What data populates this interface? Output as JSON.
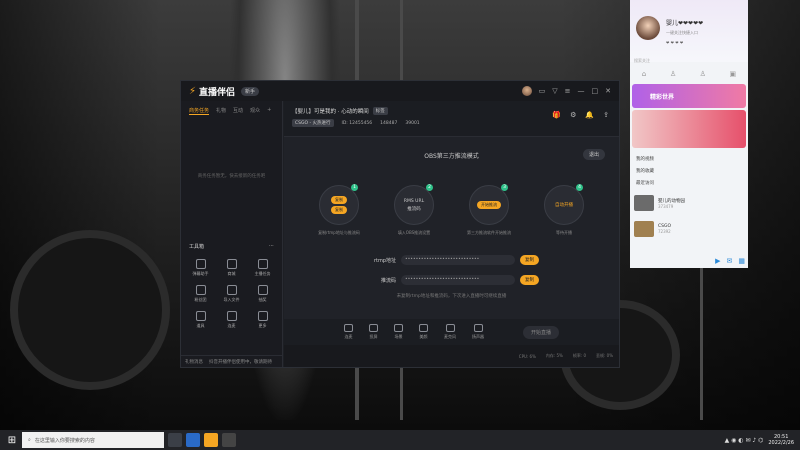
{
  "app": {
    "logo": "直播伴侣",
    "guide": "新手",
    "left_tabs": [
      "商务任务",
      "礼物",
      "互动",
      "观众"
    ],
    "empty_text": "商务任务暂无，快去接新的任务吧",
    "tools_title": "工具箱",
    "tools": [
      "弹幕助手",
      "商城",
      "主播任务",
      "粉丝团",
      "导入文件",
      "抽奖",
      "道具",
      "连麦",
      "更多"
    ],
    "footer_left": "礼物消息",
    "footer_text": "抖音开播伴侣使用中，敬请期待",
    "room": {
      "title": "【婴儿】可是我的 · 心动的瞬间",
      "title_tag": "标签",
      "category": "CSGO - 火热进行",
      "meta1": "ID: 12455456",
      "meta2": "148487",
      "meta3": "39001"
    },
    "obs": {
      "title": "OBS第三方推流模式",
      "exit": "退出",
      "steps": [
        {
          "num": "1",
          "desc": "复制rtmp地址与推流码"
        },
        {
          "num": "2",
          "label1": "RMS URL",
          "label2": "推流码",
          "desc": "填入OBS推流设置"
        },
        {
          "num": "3",
          "pill": "开始推流",
          "desc": "第三方推流软件开始推流"
        },
        {
          "num": "4",
          "label1": "自动开播",
          "desc": "等待开播"
        }
      ],
      "pill1": "复制",
      "pill2": "复制",
      "rtmp_label": "rtmp地址",
      "rtmp_value": "••••••••••••••••••••••••••••",
      "key_label": "推流码",
      "key_value": "••••••••••••••••••••••••••••",
      "copy": "复制",
      "hint": "未复制rtmp地址和推流码，下次进入直播时可继续直播"
    },
    "toolbar": [
      "连麦",
      "投屏",
      "场景",
      "美颜",
      "麦克风",
      "扬声器"
    ],
    "start": "开始直播",
    "status": [
      "CPU: 6%",
      "内存: 5%",
      "帧率: 0",
      "丢帧: 0%"
    ]
  },
  "side": {
    "name": "婴儿❤❤❤❤❤",
    "sub": "一键关注快捷入口",
    "icons": "❤ ❤ ❤ ❤",
    "search": "搜索关注",
    "banner": "精彩世界",
    "item1": "我的视频",
    "item2": "我的收藏",
    "item3": "最近访问",
    "follow1": {
      "name": "婴儿的动物园",
      "sub": "373479"
    },
    "follow2": {
      "name": "CSGO",
      "sub": "72392"
    }
  },
  "taskbar": {
    "search": "在这里输入你要搜索的内容",
    "time": "20:51",
    "date": "2022/2/26"
  }
}
